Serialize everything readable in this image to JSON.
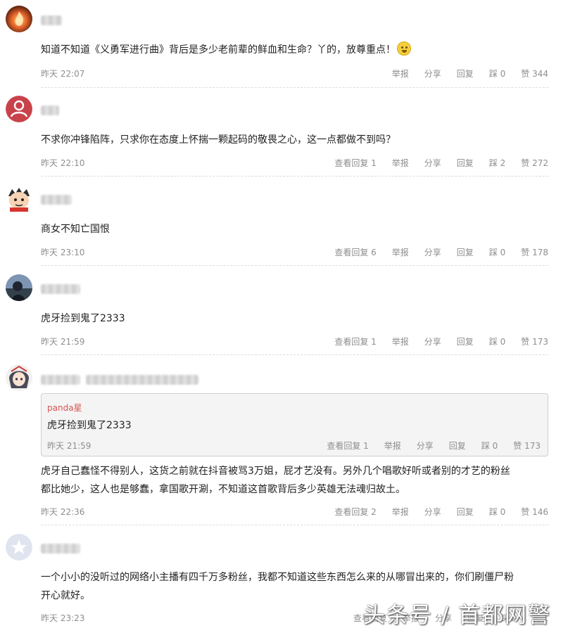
{
  "comments": [
    {
      "text": "知道不知道《义勇军进行曲》背后是多少老前辈的鲜血和生命？丫的，放尊重点！",
      "time": "昨天 22:07",
      "replies": "",
      "report": "举报",
      "share": "分享",
      "reply": "回复",
      "dislike": "踩 0",
      "like": "赞 344"
    },
    {
      "text": "不求你冲锋陷阵，只求你在态度上怀揣一颗起码的敬畏之心，这一点都做不到吗？",
      "time": "昨天 22:10",
      "replies": "查看回复 1",
      "report": "举报",
      "share": "分享",
      "reply": "回复",
      "dislike": "踩 2",
      "like": "赞 272"
    },
    {
      "text": "商女不知亡国恨",
      "time": "昨天 23:10",
      "replies": "查看回复 6",
      "report": "举报",
      "share": "分享",
      "reply": "回复",
      "dislike": "踩 0",
      "like": "赞 178"
    },
    {
      "text": "虎牙捡到鬼了2333",
      "time": "昨天 21:59",
      "replies": "查看回复 1",
      "report": "举报",
      "share": "分享",
      "reply": "回复",
      "dislike": "踩 0",
      "like": "赞 173"
    },
    {
      "quote": {
        "author": "panda星",
        "text": "虎牙捡到鬼了2333",
        "time": "昨天 21:59",
        "replies": "查看回复 1",
        "report": "举报",
        "share": "分享",
        "reply": "回复",
        "dislike": "踩 0",
        "like": "赞 173"
      },
      "text_line1": "虎牙自己蠢怪不得别人，这货之前就在抖音被骂3万姐，屁才艺没有。另外几个唱歌好听或者别的才艺的粉丝",
      "text_line2": "都比她少，这人也是够蠢，拿国歌开涮，不知道这首歌背后多少英雄无法魂归故土。",
      "time": "昨天 22:36",
      "replies": "查看回复 2",
      "report": "举报",
      "share": "分享",
      "reply": "回复",
      "dislike": "踩 0",
      "like": "赞 146"
    },
    {
      "text_line1": "一个小小的没听过的网络小主播有四千万多粉丝，我都不知道这些东西怎么来的从哪冒出来的，你们刷僵尸粉",
      "text_line2": "开心就好。",
      "time": "昨天 23:23",
      "replies": "查看回复",
      "report": "举报",
      "share": "分享",
      "reply": "回复",
      "dislike": "踩 0",
      "like": "赞 1"
    }
  ],
  "watermark": "头条号 / 首都网警",
  "icons": {
    "avatar_0": "fire-avatar-icon",
    "avatar_1": "default-user-avatar-icon",
    "avatar_2": "cartoon-avatar-icon",
    "avatar_3": "photo-avatar-icon",
    "avatar_4": "anime-avatar-icon",
    "avatar_5": "star-avatar-icon",
    "emoji": "laughing-emoji-icon"
  },
  "colors": {
    "accent": "#d8534f",
    "meta": "#8e8e8e",
    "default_avatar": "#c9424a"
  }
}
